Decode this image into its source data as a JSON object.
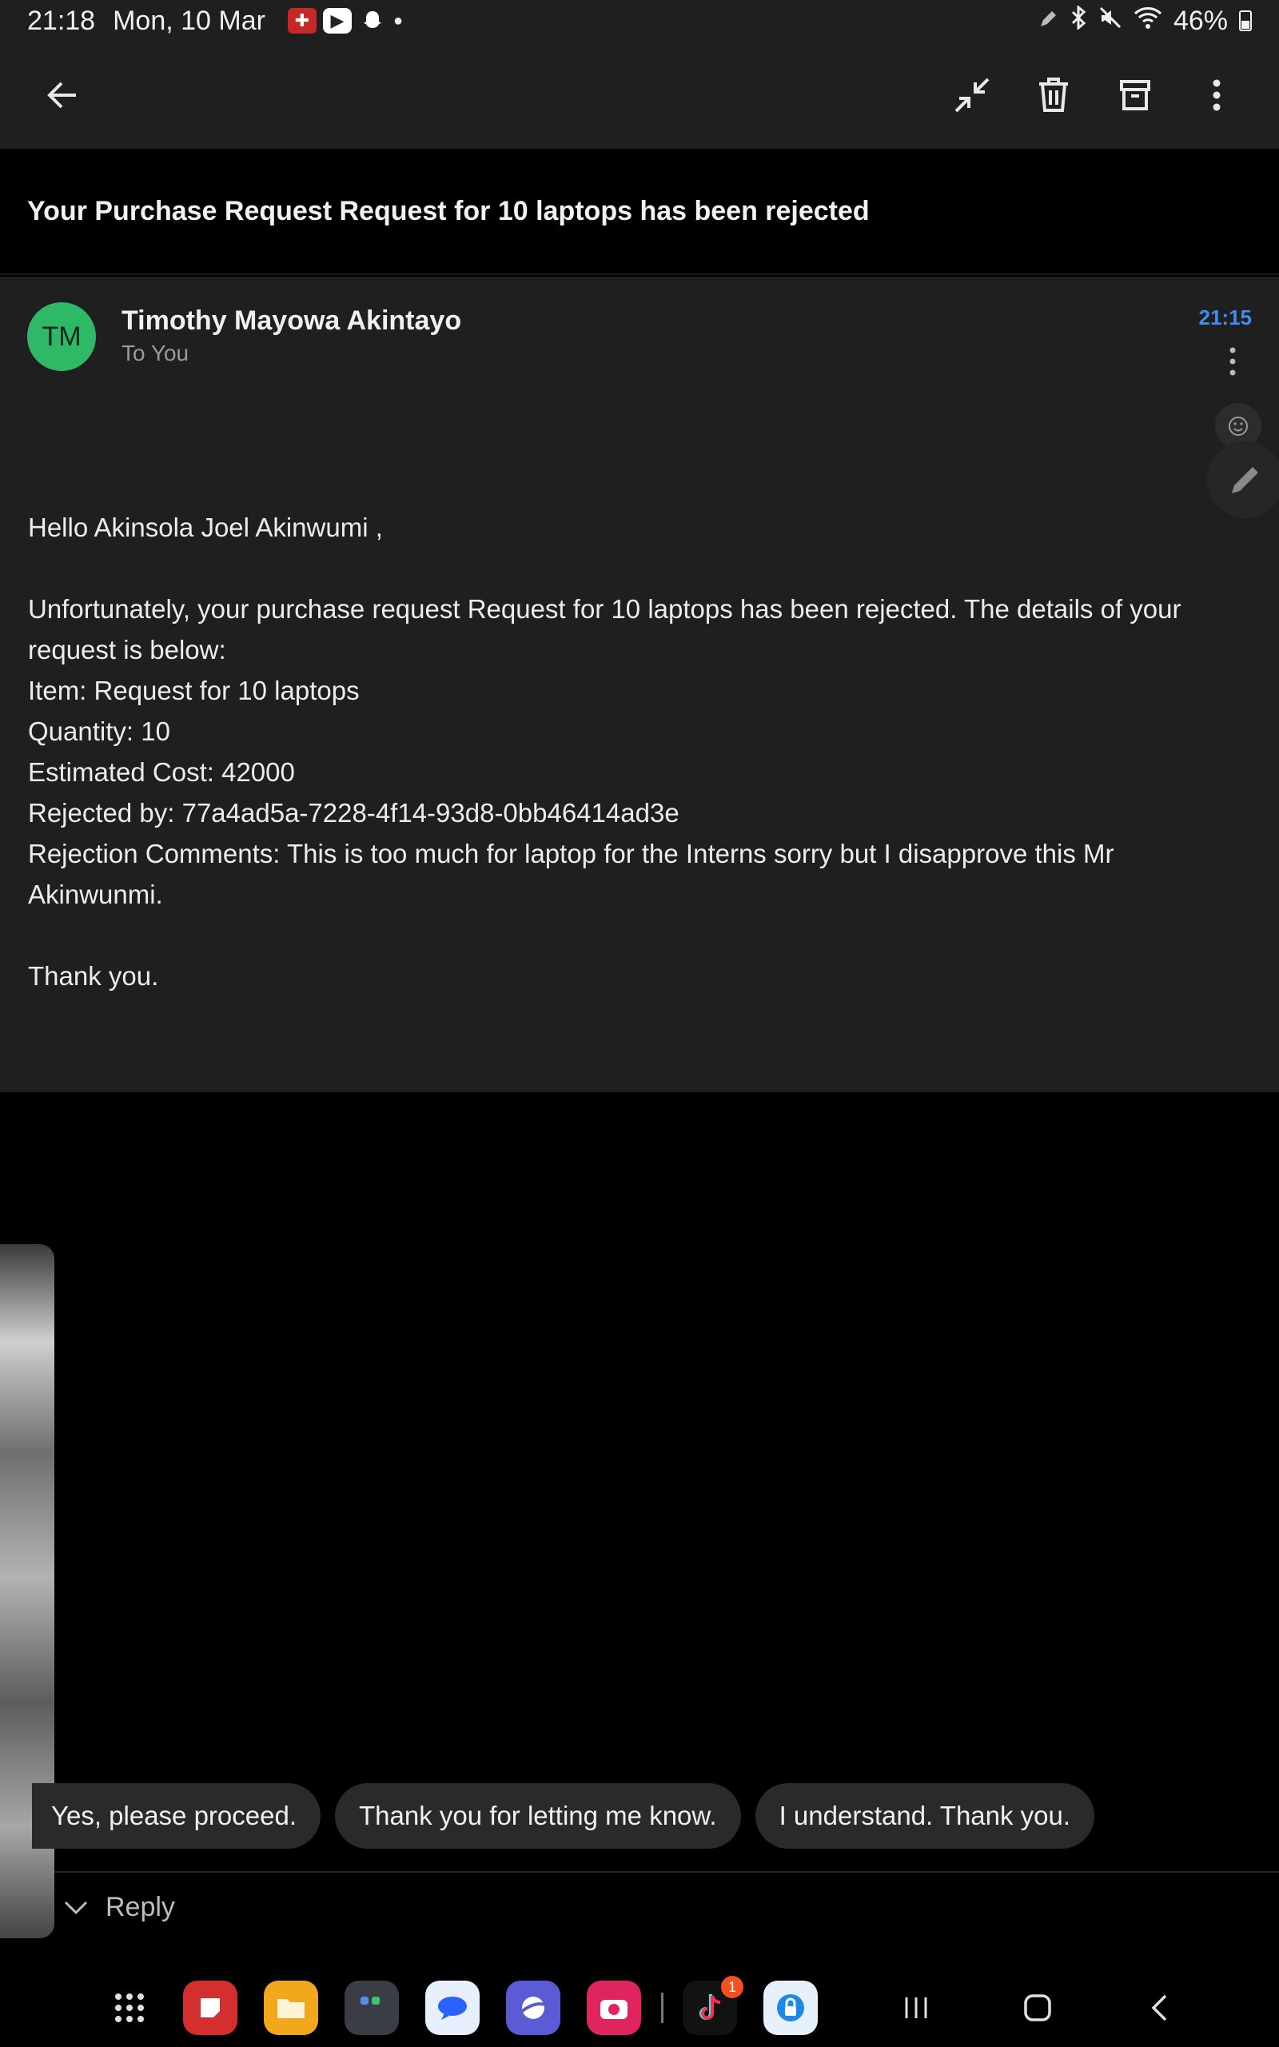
{
  "status_bar": {
    "time": "21:18",
    "date": "Mon, 10 Mar",
    "battery": "46%",
    "notification_icons": [
      "first-aid-app-icon",
      "youtube-icon",
      "snapchat-icon"
    ],
    "system_icons": [
      "pen-icon",
      "bluetooth-icon",
      "mute-icon",
      "wifi-icon",
      "battery-icon"
    ]
  },
  "toolbar": {
    "actions": [
      "back-arrow-icon",
      "collapse-icon",
      "delete-icon",
      "archive-icon",
      "more-vertical-icon"
    ]
  },
  "subject": "Your Purchase Request Request for 10 laptops  has been rejected",
  "message": {
    "avatar_initials": "TM",
    "sender": "Timothy Mayowa Akintayo",
    "recipient": "To You",
    "time": "21:15",
    "body": [
      "Hello Akinsola Joel Akinwumi ,",
      "",
      "Unfortunately, your purchase request Request for 10 laptops has been rejected. The details of your request is below:",
      "Item: Request for 10 laptops",
      "Quantity: 10",
      "Estimated Cost: 42000",
      "Rejected by: 77a4ad5a-7228-4f14-93d8-0bb46414ad3e",
      "Rejection Comments: This is too much for laptop for the Interns sorry but I disapprove this Mr Akinwunmi.",
      "",
      "Thank you."
    ]
  },
  "smart_replies": [
    "Yes, please proceed.",
    "Thank you for letting me know.",
    "I understand. Thank you."
  ],
  "reply": {
    "label": "Reply"
  },
  "taskbar": {
    "apps": [
      {
        "name": "apps-grid-icon",
        "color": "#000000"
      },
      {
        "name": "notes-app-icon",
        "color": "#d32f2f"
      },
      {
        "name": "files-app-icon",
        "color": "#f2a81d"
      },
      {
        "name": "folder-app-icon",
        "color": "#3a3d45"
      },
      {
        "name": "messages-app-icon",
        "color": "#e8f0ff"
      },
      {
        "name": "internet-app-icon",
        "color": "#5b5bd6"
      },
      {
        "name": "camera-app-icon",
        "color": "#e0245e"
      },
      {
        "name": "tiktok-app-icon",
        "color": "#121212"
      },
      {
        "name": "secure-app-icon",
        "color": "#e6f1fb"
      }
    ],
    "tiktok_badge": "1",
    "nav": [
      "recents-icon",
      "home-icon",
      "back-nav-icon"
    ]
  }
}
